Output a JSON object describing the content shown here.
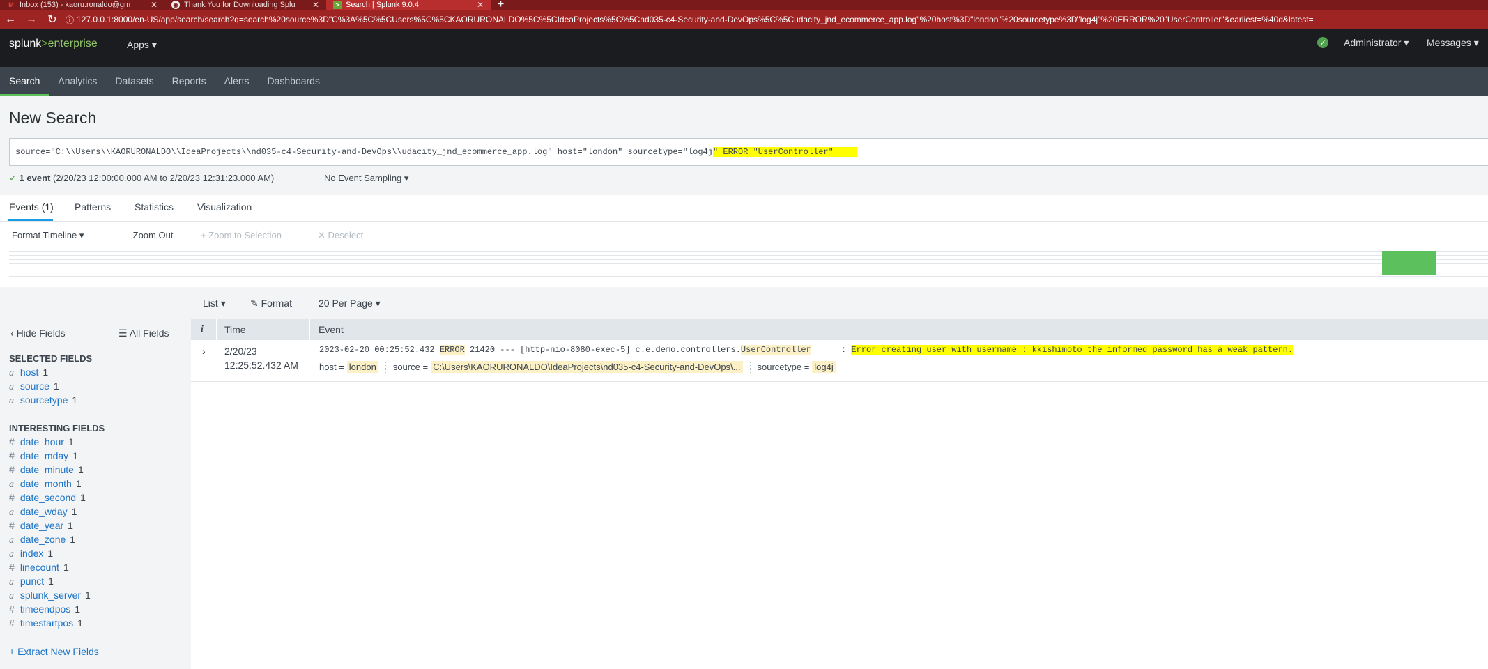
{
  "browser": {
    "tabs": [
      {
        "title": "Inbox (153) - kaoru.ronaldo@gm"
      },
      {
        "title": "Thank You for Downloading Splu"
      },
      {
        "title": "Search | Splunk 9.0.4"
      }
    ],
    "url": "127.0.0.1:8000/en-US/app/search/search?q=search%20source%3D\"C%3A%5C%5CUsers%5C%5CKAORURONALDO%5C%5CIdeaProjects%5C%5Cnd035-c4-Security-and-DevOps%5C%5Cudacity_jnd_ecommerce_app.log\"%20host%3D\"london\"%20sourcetype%3D\"log4j\"%20ERROR%20\"UserController\"&earliest=%40d&latest="
  },
  "header": {
    "logo_main": "splunk",
    "logo_sep": ">",
    "logo_suffix": "enterprise",
    "apps": "Apps",
    "user": "Administrator",
    "messages": "Messages"
  },
  "nav": [
    "Search",
    "Analytics",
    "Datasets",
    "Reports",
    "Alerts",
    "Dashboards"
  ],
  "page": {
    "title": "New Search"
  },
  "search": {
    "query_plain": "source=\"C:\\\\Users\\\\KAORURONALDO\\\\IdeaProjects\\\\nd035-c4-Security-and-DevOps\\\\udacity_jnd_ecommerce_app.log\" host=\"london\" sourcetype=\"log4j",
    "query_highlight": "\" ERROR \"UserController\""
  },
  "results_meta": {
    "check": "✓",
    "count": "1 event",
    "range": "(2/20/23 12:00:00.000 AM to 2/20/23 12:31:23.000 AM)",
    "sampling": "No Event Sampling"
  },
  "subtabs": [
    "Events (1)",
    "Patterns",
    "Statistics",
    "Visualization"
  ],
  "timeline": {
    "format": "Format Timeline",
    "zoom_out": "Zoom Out",
    "zoom_selection": "Zoom to Selection",
    "deselect": "Deselect"
  },
  "results_toolbar": {
    "list": "List",
    "format": "Format",
    "per_page": "20 Per Page"
  },
  "sidebar": {
    "hide_fields": "Hide Fields",
    "all_fields": "All Fields",
    "selected_heading": "SELECTED FIELDS",
    "selected": [
      {
        "type": "a",
        "name": "host",
        "count": "1"
      },
      {
        "type": "a",
        "name": "source",
        "count": "1"
      },
      {
        "type": "a",
        "name": "sourcetype",
        "count": "1"
      }
    ],
    "interesting_heading": "INTERESTING FIELDS",
    "interesting": [
      {
        "type": "#",
        "name": "date_hour",
        "count": "1"
      },
      {
        "type": "#",
        "name": "date_mday",
        "count": "1"
      },
      {
        "type": "#",
        "name": "date_minute",
        "count": "1"
      },
      {
        "type": "a",
        "name": "date_month",
        "count": "1"
      },
      {
        "type": "#",
        "name": "date_second",
        "count": "1"
      },
      {
        "type": "a",
        "name": "date_wday",
        "count": "1"
      },
      {
        "type": "#",
        "name": "date_year",
        "count": "1"
      },
      {
        "type": "a",
        "name": "date_zone",
        "count": "1"
      },
      {
        "type": "a",
        "name": "index",
        "count": "1"
      },
      {
        "type": "#",
        "name": "linecount",
        "count": "1"
      },
      {
        "type": "a",
        "name": "punct",
        "count": "1"
      },
      {
        "type": "a",
        "name": "splunk_server",
        "count": "1"
      },
      {
        "type": "#",
        "name": "timeendpos",
        "count": "1"
      },
      {
        "type": "#",
        "name": "timestartpos",
        "count": "1"
      }
    ],
    "extract": "+ Extract New Fields"
  },
  "table": {
    "col_info": "i",
    "col_time": "Time",
    "col_event": "Event",
    "row": {
      "date": "2/20/23",
      "time": "12:25:52.432 AM",
      "raw_a": "2023-02-20 00:25:52.432 ",
      "raw_error": "ERROR",
      "raw_b": " 21420 --- [http-nio-8080-exec-5] c.e.demo.controllers.",
      "raw_controller": "UserController",
      "raw_c": "      : ",
      "raw_message": "Error creating user with username : kkishimoto the informed password has a weak pattern.",
      "host_label": "host =",
      "host_value": "london",
      "source_label": "source =",
      "source_value": "C:\\Users\\KAORURONALDO\\IdeaProjects\\nd035-c4-Security-and-DevOps\\...",
      "sourcetype_label": "sourcetype =",
      "sourcetype_value": "log4j"
    }
  },
  "colors": {
    "tab_bar": "#7a1a1a",
    "url_bar": "#9e2424",
    "splunk_green": "#65a637",
    "highlight": "#ffff00",
    "timeline_bar": "#5cc05c"
  }
}
